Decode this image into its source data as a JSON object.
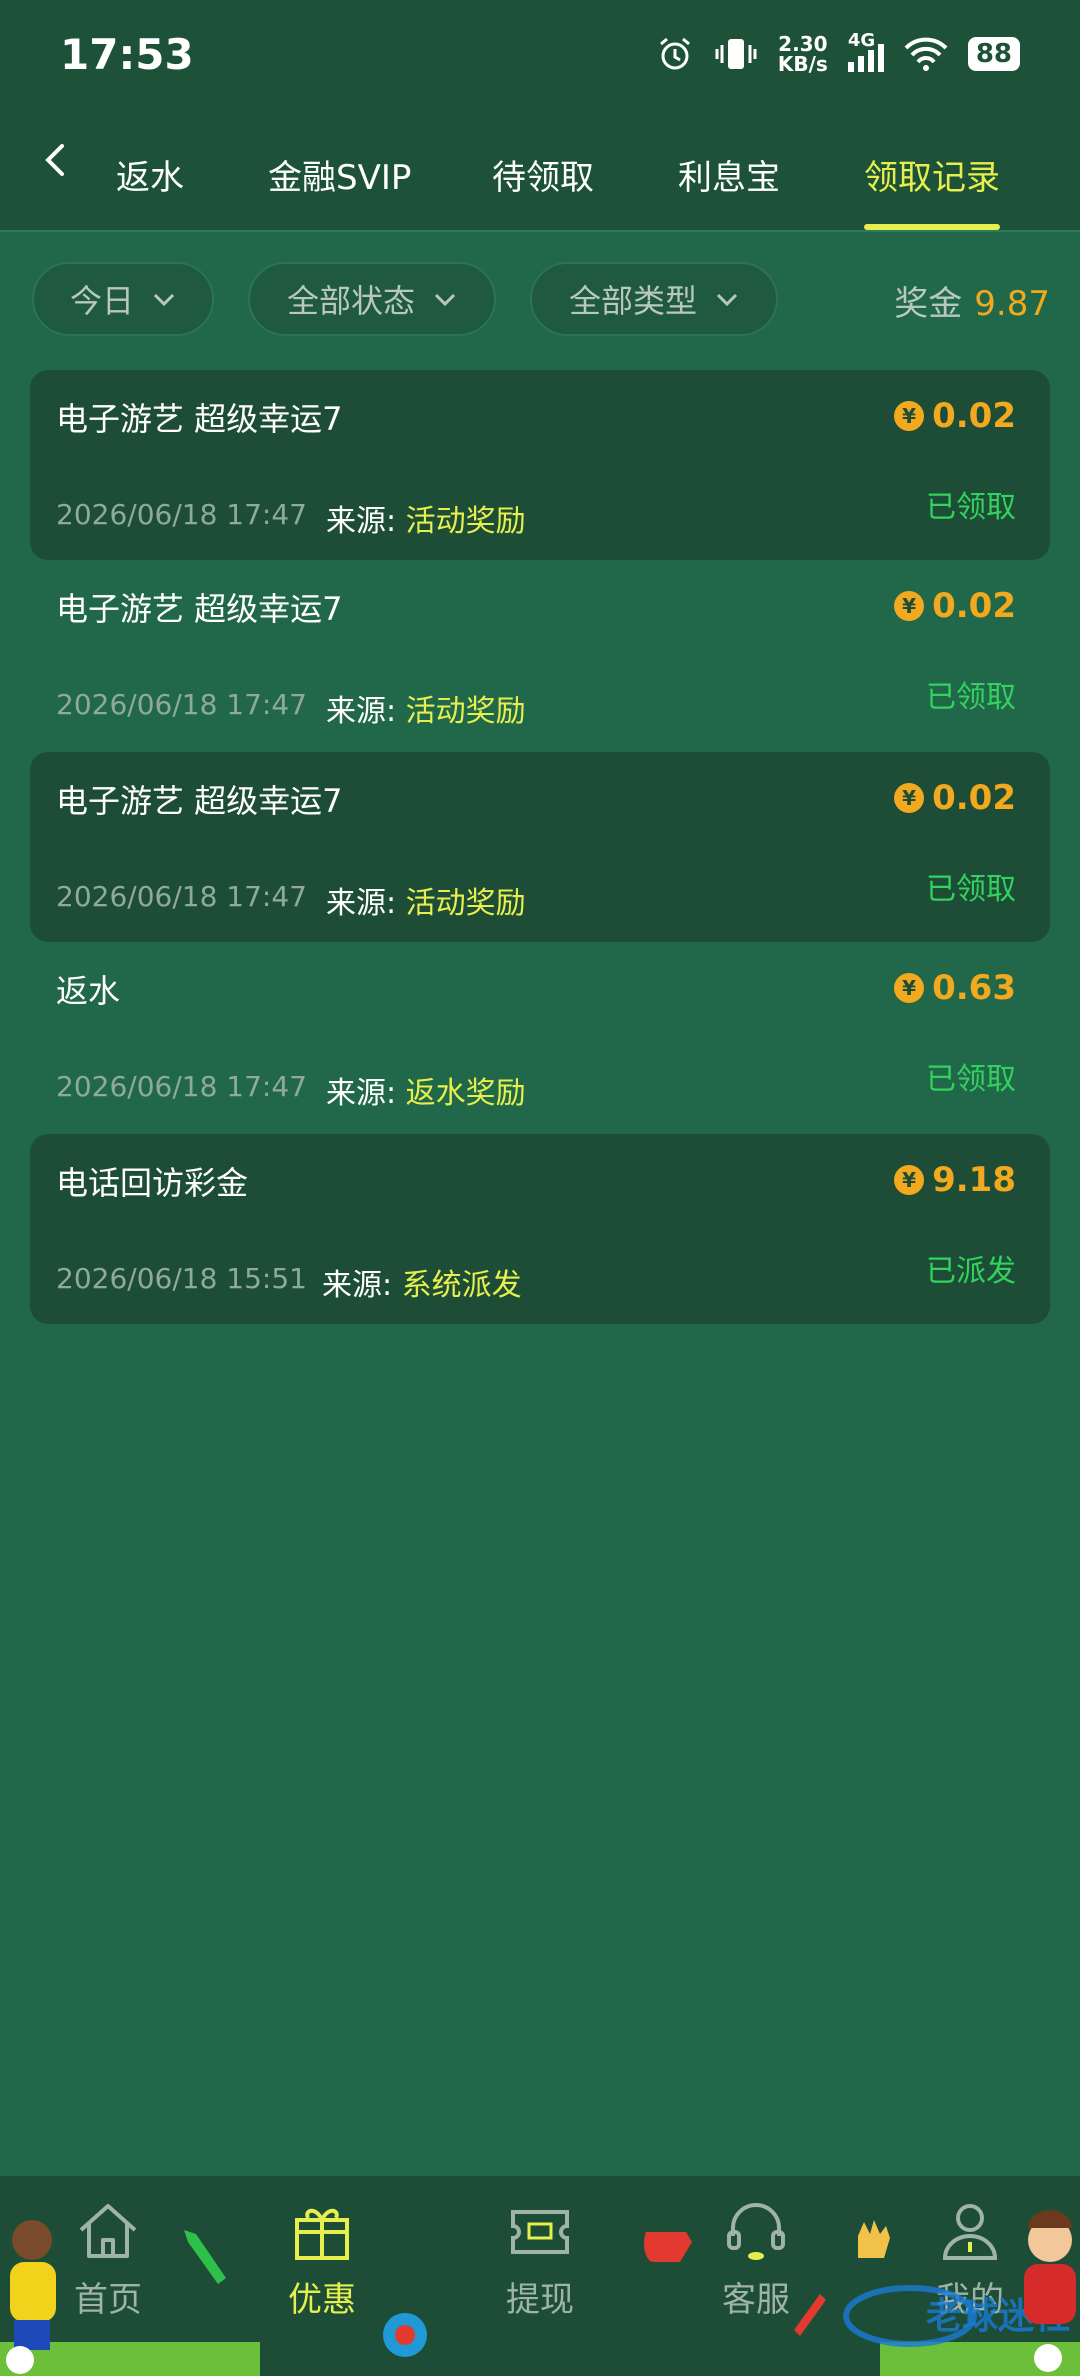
{
  "status_bar": {
    "time": "17:53",
    "net_speed": "2.30",
    "net_unit": "KB/s",
    "network_type": "4G",
    "battery": "88"
  },
  "tabs": [
    {
      "label": "返水"
    },
    {
      "label": "金融SVIP"
    },
    {
      "label": "待领取"
    },
    {
      "label": "利息宝"
    },
    {
      "label": "领取记录",
      "active": true
    }
  ],
  "filters": {
    "date": "今日",
    "status": "全部状态",
    "type": "全部类型"
  },
  "bonus": {
    "label": "奖金",
    "value": "9.87"
  },
  "records": [
    {
      "title": "电子游艺 超级幸运7",
      "amount": "0.02",
      "date": "2026/06/18 17:47",
      "source_label": "来源:",
      "source": "活动奖励",
      "status": "已领取"
    },
    {
      "title": "电子游艺 超级幸运7",
      "amount": "0.02",
      "date": "2026/06/18 17:47",
      "source_label": "来源:",
      "source": "活动奖励",
      "status": "已领取"
    },
    {
      "title": "电子游艺 超级幸运7",
      "amount": "0.02",
      "date": "2026/06/18 17:47",
      "source_label": "来源:",
      "source": "活动奖励",
      "status": "已领取"
    },
    {
      "title": "返水",
      "amount": "0.63",
      "date": "2026/06/18 17:47",
      "source_label": "来源:",
      "source": "返水奖励",
      "status": "已领取"
    },
    {
      "title": "电话回访彩金",
      "amount": "9.18",
      "date": "2026/06/18 15:51",
      "source_label": "来源:",
      "source": "系统派发",
      "status": "已派发"
    }
  ],
  "coin_symbol": "¥",
  "bottom_nav": [
    {
      "label": "首页"
    },
    {
      "label": "优惠",
      "active": true
    },
    {
      "label": "提现"
    },
    {
      "label": "客服"
    },
    {
      "label": "我的"
    }
  ],
  "colors": {
    "accent": "#e6ef4d",
    "gold": "#f2a91d",
    "success": "#33d15e",
    "header_bg": "#1e5238",
    "page_bg": "#21684a"
  }
}
